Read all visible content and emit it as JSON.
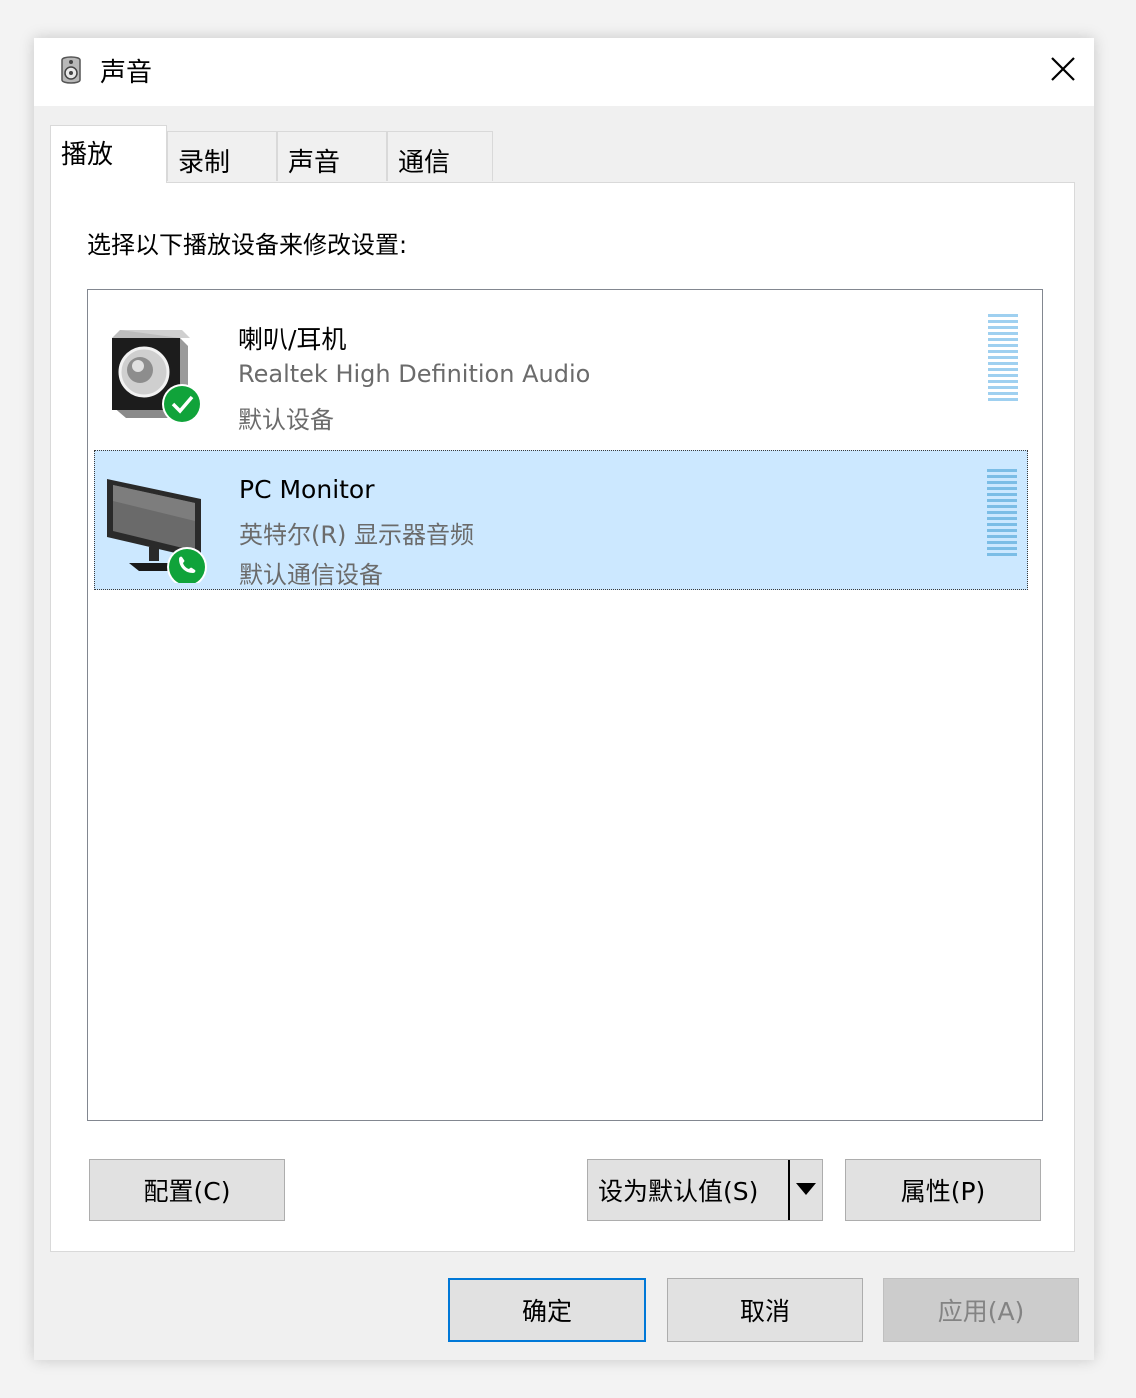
{
  "window": {
    "title": "声音",
    "close_symbol": "✕"
  },
  "tabs": [
    {
      "label": "播放",
      "active": true
    },
    {
      "label": "录制",
      "active": false
    },
    {
      "label": "声音",
      "active": false
    },
    {
      "label": "通信",
      "active": false
    }
  ],
  "panel": {
    "instruction": "选择以下播放设备来修改设置:"
  },
  "devices": [
    {
      "name": "喇叭/耳机",
      "driver": "Realtek High Definition Audio",
      "status": "默认设备",
      "icon": "speaker-icon",
      "badge": "checkmark-icon",
      "selected": false
    },
    {
      "name": "PC Monitor",
      "driver": "英特尔(R) 显示器音频",
      "status": "默认通信设备",
      "icon": "monitor-icon",
      "badge": "phone-icon",
      "selected": true
    }
  ],
  "buttons": {
    "configure": "配置(C)",
    "set_default": "设为默认值(S)",
    "properties": "属性(P)",
    "ok": "确定",
    "cancel": "取消",
    "apply": "应用(A)"
  },
  "colors": {
    "selection_bg": "#cce8ff",
    "badge_green": "#10a33a",
    "focus_border": "#0078d7",
    "meter_blue": "#9fd0f0"
  }
}
